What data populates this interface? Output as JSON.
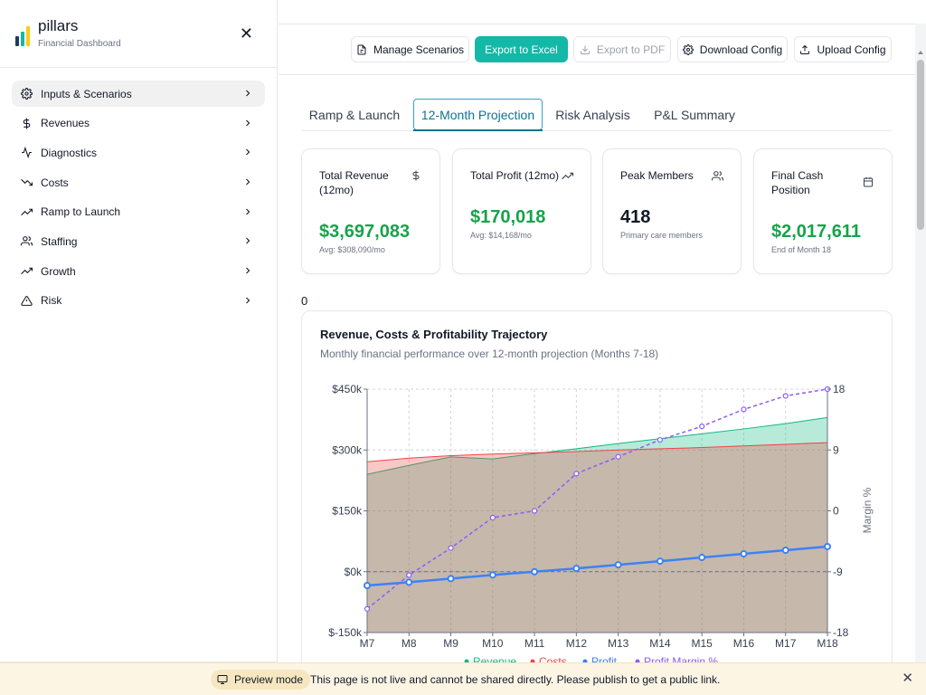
{
  "app": {
    "name": "pillars",
    "subtitle": "Financial Dashboard"
  },
  "sidebar": {
    "items": [
      {
        "label": "Inputs & Scenarios",
        "icon": "gear-icon",
        "active": true
      },
      {
        "label": "Revenues",
        "icon": "dollar-icon"
      },
      {
        "label": "Diagnostics",
        "icon": "activity-icon"
      },
      {
        "label": "Costs",
        "icon": "trending-down-icon"
      },
      {
        "label": "Ramp to Launch",
        "icon": "trending-up-icon"
      },
      {
        "label": "Staffing",
        "icon": "users-icon"
      },
      {
        "label": "Growth",
        "icon": "trending-up-icon"
      },
      {
        "label": "Risk",
        "icon": "alert-triangle-icon"
      }
    ]
  },
  "toolbar": {
    "manage_scenarios": "Manage Scenarios",
    "export_excel": "Export to Excel",
    "export_pdf": "Export to PDF",
    "download_config": "Download Config",
    "upload_config": "Upload Config"
  },
  "tabs": [
    "Ramp & Launch",
    "12-Month Projection",
    "Risk Analysis",
    "P&L Summary"
  ],
  "kpis": [
    {
      "title": "Total Revenue (12mo)",
      "value": "$3,697,083",
      "sub": "Avg: $308,090/mo",
      "icon": "dollar-icon",
      "color": "#16a34a"
    },
    {
      "title": "Total Profit (12mo)",
      "value": "$170,018",
      "sub": "Avg: $14,168/mo",
      "icon": "trending-up-icon",
      "color": "#16a34a"
    },
    {
      "title": "Peak Members",
      "value": "418",
      "sub": "Primary care members",
      "icon": "users-icon",
      "color": "#111827"
    },
    {
      "title": "Final Cash Position",
      "value": "$2,017,611",
      "sub": "End of Month 18",
      "icon": "calendar-icon",
      "color": "#16a34a"
    }
  ],
  "stray_value": "0",
  "chart": {
    "title": "Revenue, Costs & Profitability Trajectory",
    "subtitle": "Monthly financial performance over 12-month projection (Months 7-18)"
  },
  "chart_data": {
    "type": "area",
    "categories": [
      "M7",
      "M8",
      "M9",
      "M10",
      "M11",
      "M12",
      "M13",
      "M14",
      "M15",
      "M16",
      "M17",
      "M18"
    ],
    "series": [
      {
        "name": "Revenue",
        "type": "area",
        "axis": "left",
        "color": "#10b981",
        "values": [
          240000,
          262000,
          283000,
          278000,
          291000,
          303000,
          316000,
          328000,
          340000,
          352000,
          365000,
          380000
        ]
      },
      {
        "name": "Costs",
        "type": "area",
        "axis": "left",
        "color": "#ef4444",
        "values": [
          271000,
          280000,
          286000,
          290000,
          293000,
          296000,
          300000,
          303000,
          306000,
          310000,
          314000,
          318000
        ]
      },
      {
        "name": "Profit",
        "type": "line",
        "axis": "left",
        "color": "#3b82f6",
        "values": [
          -34000,
          -26000,
          -17000,
          -8000,
          0,
          8000,
          17000,
          26000,
          35000,
          44000,
          53000,
          62000
        ]
      },
      {
        "name": "Profit Margin %",
        "type": "line",
        "axis": "right",
        "color": "#8b5cf6",
        "dashed": true,
        "values": [
          -14.5,
          -9.5,
          -5.5,
          -1,
          0,
          5.5,
          8,
          10.5,
          12.5,
          15,
          17,
          18
        ]
      }
    ],
    "y_left": {
      "ticks": [
        "$450k",
        "$300k",
        "$150k",
        "$0k",
        "$-150k"
      ],
      "values": [
        450000,
        300000,
        150000,
        0,
        -150000
      ],
      "ylim": [
        -150000,
        450000
      ]
    },
    "y_right": {
      "label": "Margin %",
      "ticks": [
        "18",
        "9",
        "0",
        "-9",
        "-18"
      ],
      "values": [
        18,
        9,
        0,
        -9,
        -18
      ],
      "ylim": [
        -18,
        18
      ]
    },
    "grid": true,
    "legend_position": "bottom"
  },
  "banner": {
    "pill": "Preview mode",
    "message": "This page is not live and cannot be shared directly. Please publish to get a public link."
  }
}
